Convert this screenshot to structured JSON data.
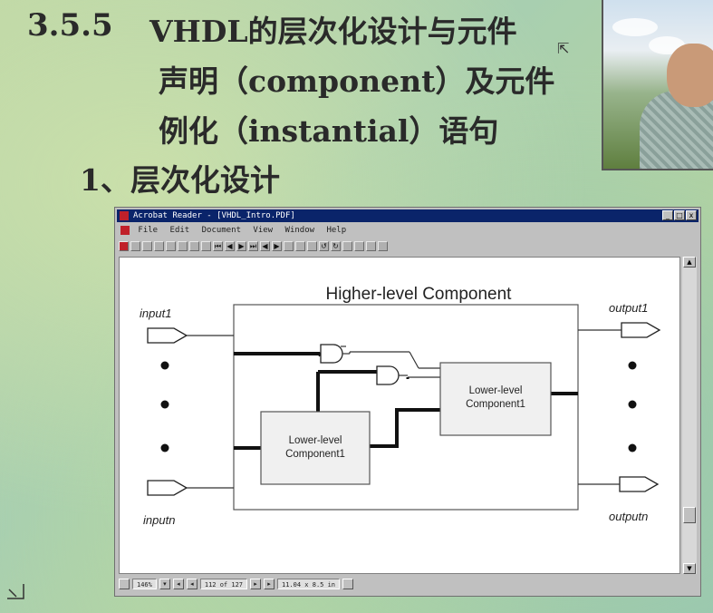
{
  "slide": {
    "section_number": "3.5.5",
    "title_line1": "VHDL的层次化设计与元件",
    "title_line2": "声明（component）及元件",
    "title_line3": "例化（instantial）语句",
    "subheading": "1、层次化设计"
  },
  "acrobat": {
    "title": "Acrobat Reader - [VHDL_Intro.PDF]",
    "menus": [
      "File",
      "Edit",
      "Document",
      "View",
      "Window",
      "Help"
    ],
    "window_buttons": [
      "_",
      "□",
      "x"
    ],
    "status": {
      "zoom": "146%",
      "page": "112 of 127",
      "size": "11.04 x 8.5 in"
    }
  },
  "diagram": {
    "outer_label": "Higher-level Component",
    "input_top": "input1",
    "input_bottom": "inputn",
    "output_top": "output1",
    "output_bottom": "outputn",
    "lower_left_line1": "Lower-level",
    "lower_left_line2": "Component1",
    "lower_right_line1": "Lower-level",
    "lower_right_line2": "Component1"
  },
  "colors": {
    "title_text": "#2a2a2a",
    "acrobat_titlebar": "#0a246a",
    "acrobat_icon_red": "#c0202a"
  },
  "icons": [
    "pointer-cursor-icon",
    "acrobat-app-icon",
    "minimize-icon",
    "maximize-icon",
    "close-icon",
    "scroll-up-icon",
    "scroll-down-icon",
    "and-gate-icon"
  ]
}
